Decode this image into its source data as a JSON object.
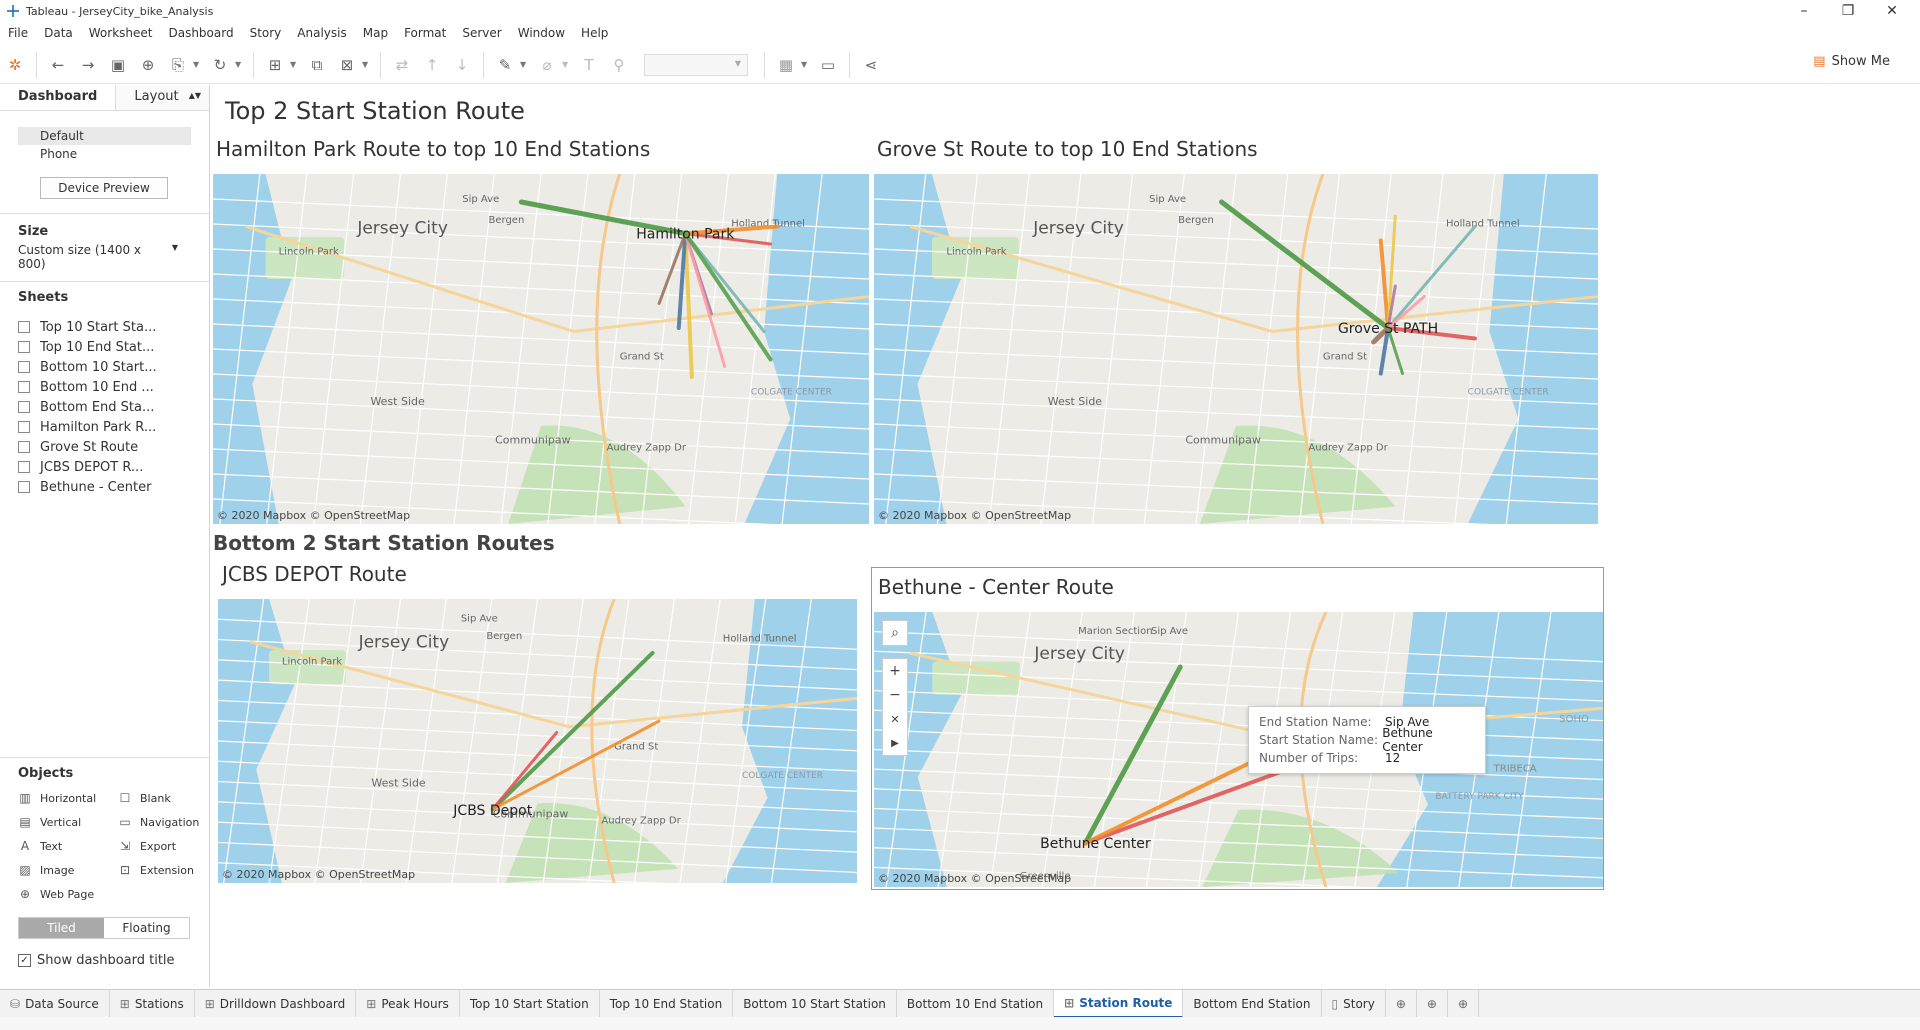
{
  "window": {
    "title": "Tableau - JerseyCity_bike_Analysis"
  },
  "menu": [
    "File",
    "Data",
    "Worksheet",
    "Dashboard",
    "Story",
    "Analysis",
    "Map",
    "Format",
    "Server",
    "Window",
    "Help"
  ],
  "toolbar": {
    "show_me": "Show Me"
  },
  "left_pane": {
    "tab_dashboard": "Dashboard",
    "tab_layout": "Layout",
    "device_default": "Default",
    "device_phone": "Phone",
    "device_preview": "Device Preview",
    "size_label": "Size",
    "size_value": "Custom size (1400 x 800)",
    "sheets_label": "Sheets",
    "sheets": [
      "Top 10 Start Sta...",
      "Top 10 End Stat...",
      "Bottom 10 Start...",
      "Bottom 10 End ...",
      "Bottom End Sta...",
      "Hamilton Park R...",
      "Grove St Route",
      "JCBS DEPOT R...",
      "Bethune - Center"
    ],
    "objects_label": "Objects",
    "objects": [
      {
        "label": "Horizontal",
        "icon": "horizontal-icon",
        "glyph": "▥"
      },
      {
        "label": "Blank",
        "icon": "blank-icon",
        "glyph": "☐"
      },
      {
        "label": "Vertical",
        "icon": "vertical-icon",
        "glyph": "▤"
      },
      {
        "label": "Navigation",
        "icon": "navigation-icon",
        "glyph": "▭"
      },
      {
        "label": "Text",
        "icon": "text-icon",
        "glyph": "A"
      },
      {
        "label": "Export",
        "icon": "export-icon",
        "glyph": "⇲"
      },
      {
        "label": "Image",
        "icon": "image-icon",
        "glyph": "▨"
      },
      {
        "label": "Extension",
        "icon": "extension-icon",
        "glyph": "⊡"
      },
      {
        "label": "Web Page",
        "icon": "web-page-icon",
        "glyph": "⊕"
      }
    ],
    "tiled": "Tiled",
    "floating": "Floating",
    "show_title": "Show dashboard title"
  },
  "dashboard": {
    "title": "Top 2 Start Station Route",
    "hamilton_title": "Hamilton Park Route to  top 10 End Stations",
    "grove_title": "Grove St Route to top 10 End Stations",
    "bottom_section": "Bottom 2 Start Station Routes",
    "jcbs_title": "JCBS DEPOT Route",
    "bethune_title": "Bethune - Center Route",
    "attribution": "© 2020 Mapbox © OpenStreetMap",
    "map_labels": {
      "jersey_city": "Jersey City",
      "lincoln_park": "Lincoln Park",
      "west_side": "West Side",
      "communipaw": "Communipaw",
      "bergen": "Bergen",
      "sip_ave": "Sip Ave",
      "holland_tunnel": "Holland Tunnel",
      "colgate_center": "COLGATE CENTER",
      "audrey_zapp": "Audrey Zapp Dr",
      "grand_st": "Grand St",
      "marion_section": "Marion Section",
      "greenville": "Greenville",
      "tribeca": "TRIBECA",
      "battery_park": "BATTERY PARK CITY",
      "soho": "SOHO"
    },
    "stations": {
      "hamilton": "Hamilton Park",
      "grove": "Grove St PATH",
      "jcbs": "JCBS Depot",
      "bethune": "Bethune Center"
    },
    "tooltip": {
      "end_label": "End Station Name:",
      "end_value": "Sip Ave",
      "start_label": "Start Station Name:",
      "start_value": "Bethune Center",
      "trips_label": "Number of Trips:",
      "trips_value": "12"
    },
    "route_colors": [
      "#4e9a45",
      "#e15759",
      "#f28e2b",
      "#edc948",
      "#4e79a7",
      "#76b7b2",
      "#b07aa1",
      "#9c755f",
      "#ff9da7",
      "#59a14f"
    ]
  },
  "bottom_tabs": [
    {
      "label": "Data Source",
      "icon": "database-icon"
    },
    {
      "label": "Stations",
      "icon": "grid-icon"
    },
    {
      "label": "Drilldown Dashboard",
      "icon": "grid-icon"
    },
    {
      "label": "Peak Hours",
      "icon": "grid-icon"
    },
    {
      "label": "Top 10 Start Station",
      "icon": ""
    },
    {
      "label": "Top 10 End Station",
      "icon": ""
    },
    {
      "label": "Bottom 10 Start Station",
      "icon": ""
    },
    {
      "label": "Bottom 10 End Station",
      "icon": ""
    },
    {
      "label": "Station Route",
      "icon": "grid-icon",
      "active": true
    },
    {
      "label": "Bottom End Station",
      "icon": ""
    },
    {
      "label": "Story",
      "icon": "story-icon"
    }
  ]
}
